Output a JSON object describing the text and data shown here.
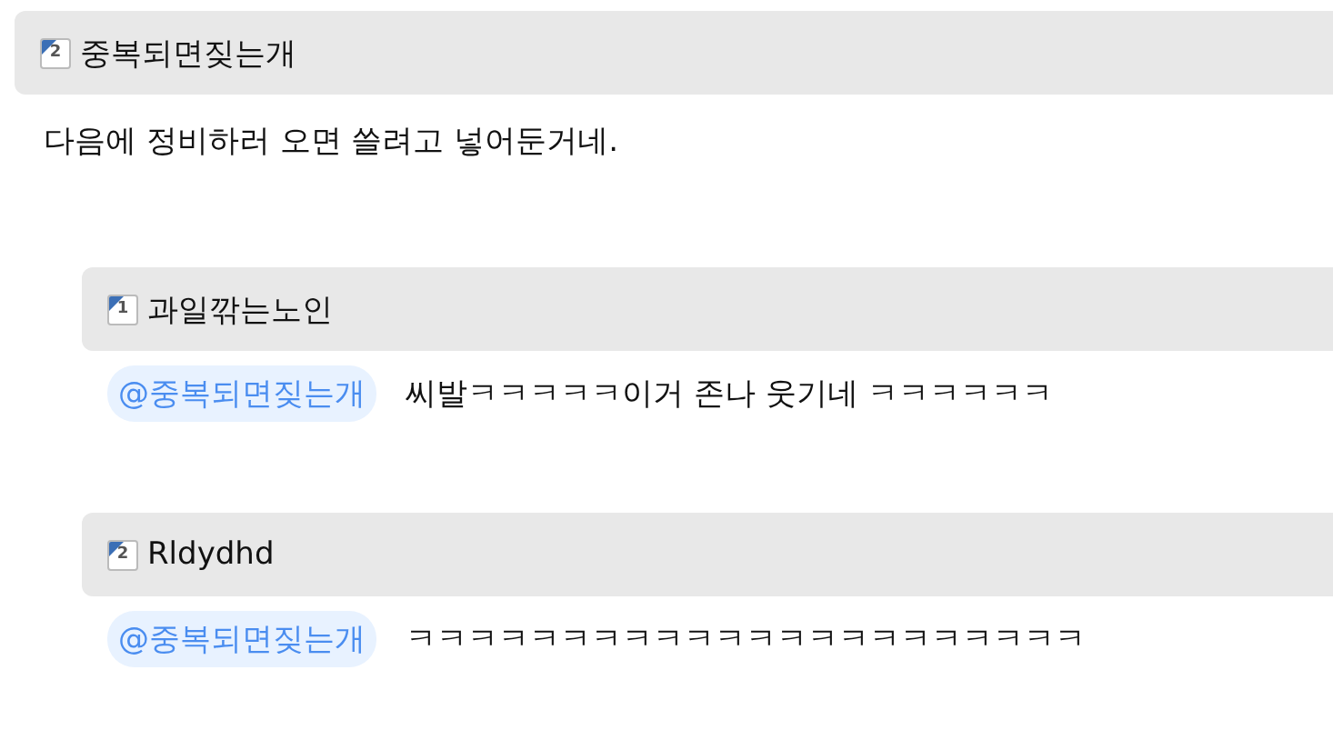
{
  "comment": {
    "author": "중복되면짖는개",
    "rank": "2",
    "text": "다음에 정비하러 오면 쓸려고 넣어둔거네.",
    "replies": [
      {
        "author": "과일깎는노인",
        "rank": "1",
        "mention": "@중복되면짖는개",
        "text": "씨발ㅋㅋㅋㅋㅋ이거 존나 웃기네 ㅋㅋㅋㅋㅋㅋ"
      },
      {
        "author": "Rldydhd",
        "rank": "2",
        "mention": "@중복되면짖는개",
        "text": "ㅋㅋㅋㅋㅋㅋㅋㅋㅋㅋㅋㅋㅋㅋㅋㅋㅋㅋㅋㅋㅋㅋ"
      }
    ]
  }
}
